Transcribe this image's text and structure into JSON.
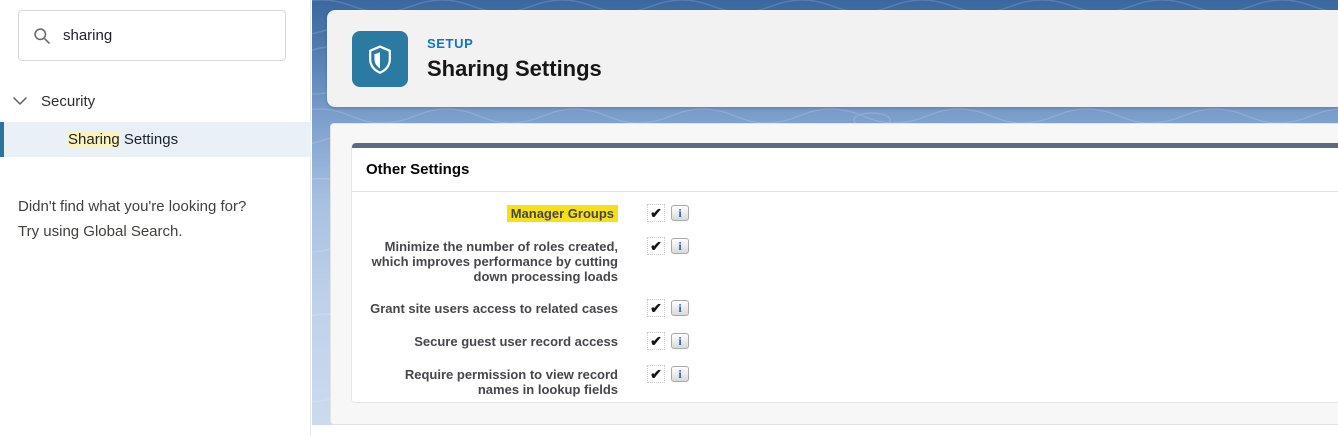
{
  "sidebar": {
    "search": {
      "value": "sharing",
      "icon": "search-icon"
    },
    "tree": {
      "branch_label": "Security",
      "branch_icon": "chevron-down-icon",
      "selected": {
        "highlighted_part": "Sharing",
        "rest": " Settings"
      }
    },
    "hint_line1": "Didn't find what you're looking for?",
    "hint_line2": "Try using Global Search."
  },
  "header": {
    "eyebrow": "SETUP",
    "title": "Sharing Settings",
    "icon": "shield-icon",
    "icon_bg_color": "#2b7aa2",
    "eyebrow_color": "#0b76c8"
  },
  "panel": {
    "title": "Other Settings",
    "topbar_color": "#5a6a87",
    "highlight_color": "#f7e017",
    "rows": [
      {
        "label": "Manager Groups",
        "highlighted": true,
        "checked": true
      },
      {
        "label": "Minimize the number of roles created, which improves performance by cutting down processing loads",
        "highlighted": false,
        "checked": true
      },
      {
        "label": "Grant site users access to related cases",
        "highlighted": false,
        "checked": true
      },
      {
        "label": "Secure guest user record access",
        "highlighted": false,
        "checked": true
      },
      {
        "label": "Require permission to view record names in lookup fields",
        "highlighted": false,
        "checked": true
      }
    ]
  },
  "icons": {
    "check_glyph": "✔",
    "info_glyph": "i"
  }
}
